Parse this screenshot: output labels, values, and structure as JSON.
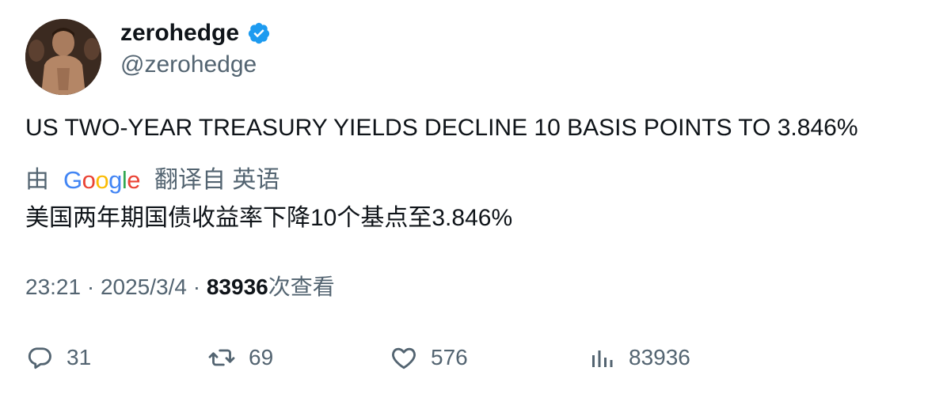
{
  "author": {
    "display_name": "zerohedge",
    "handle": "@zerohedge",
    "verified_badge_icon": "verified-badge-icon",
    "verified_color": "#1d9bf0"
  },
  "tweet": {
    "text": "US TWO-YEAR TREASURY YIELDS DECLINE 10 BASIS POINTS TO 3.846%"
  },
  "translation": {
    "prefix": "由",
    "provider_logo": "Google",
    "suffix": "翻译自 英语",
    "text": "美国两年期国债收益率下降10个基点至3.846%"
  },
  "meta": {
    "time": "23:21",
    "separator": "·",
    "date": "2025/3/4",
    "views_count": "83936",
    "views_label": "次查看"
  },
  "actions": {
    "reply": {
      "icon": "reply-icon",
      "count": "31"
    },
    "retweet": {
      "icon": "retweet-icon",
      "count": "69"
    },
    "like": {
      "icon": "heart-icon",
      "count": "576"
    },
    "views": {
      "icon": "bar-chart-icon",
      "count": "83936"
    }
  },
  "colors": {
    "text_primary": "#0f1419",
    "text_secondary": "#536471",
    "accent": "#1d9bf0"
  }
}
